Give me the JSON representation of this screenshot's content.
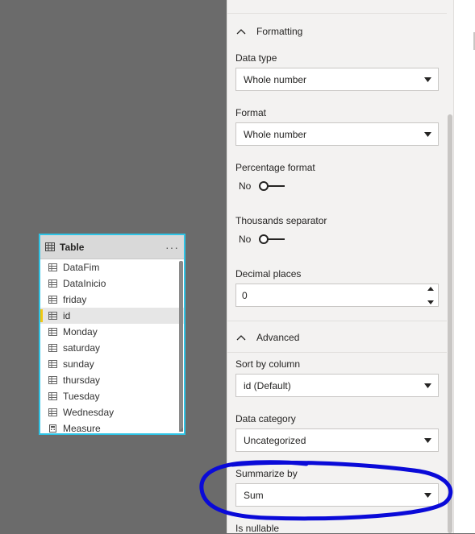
{
  "table": {
    "title": "Table",
    "more": "···",
    "fields": [
      {
        "name": "DataFim",
        "icon": "table-column-icon"
      },
      {
        "name": "DataInicio",
        "icon": "table-column-icon"
      },
      {
        "name": "friday",
        "icon": "table-column-icon"
      },
      {
        "name": "id",
        "icon": "table-column-icon",
        "selected": true
      },
      {
        "name": "Monday",
        "icon": "table-column-icon"
      },
      {
        "name": "saturday",
        "icon": "table-column-icon"
      },
      {
        "name": "sunday",
        "icon": "table-column-icon"
      },
      {
        "name": "thursday",
        "icon": "table-column-icon"
      },
      {
        "name": "Tuesday",
        "icon": "table-column-icon"
      },
      {
        "name": "Wednesday",
        "icon": "table-column-icon"
      },
      {
        "name": "Measure",
        "icon": "calculator-icon"
      }
    ]
  },
  "properties": {
    "formatting": {
      "header": "Formatting",
      "data_type_label": "Data type",
      "data_type_value": "Whole number",
      "format_label": "Format",
      "format_value": "Whole number",
      "percentage_label": "Percentage format",
      "percentage_value": "No",
      "thousands_label": "Thousands separator",
      "thousands_value": "No",
      "decimal_label": "Decimal places",
      "decimal_value": "0"
    },
    "advanced": {
      "header": "Advanced",
      "sort_label": "Sort by column",
      "sort_value": "id (Default)",
      "category_label": "Data category",
      "category_value": "Uncategorized",
      "summarize_label": "Summarize by",
      "summarize_value": "Sum",
      "nullable_label": "Is nullable"
    }
  },
  "colors": {
    "canvas": "#6b6b6b",
    "selected_card_border": "#2ec4e6",
    "selected_field_marker": "#f2c811",
    "annotation_ink": "#0a0ad8"
  }
}
